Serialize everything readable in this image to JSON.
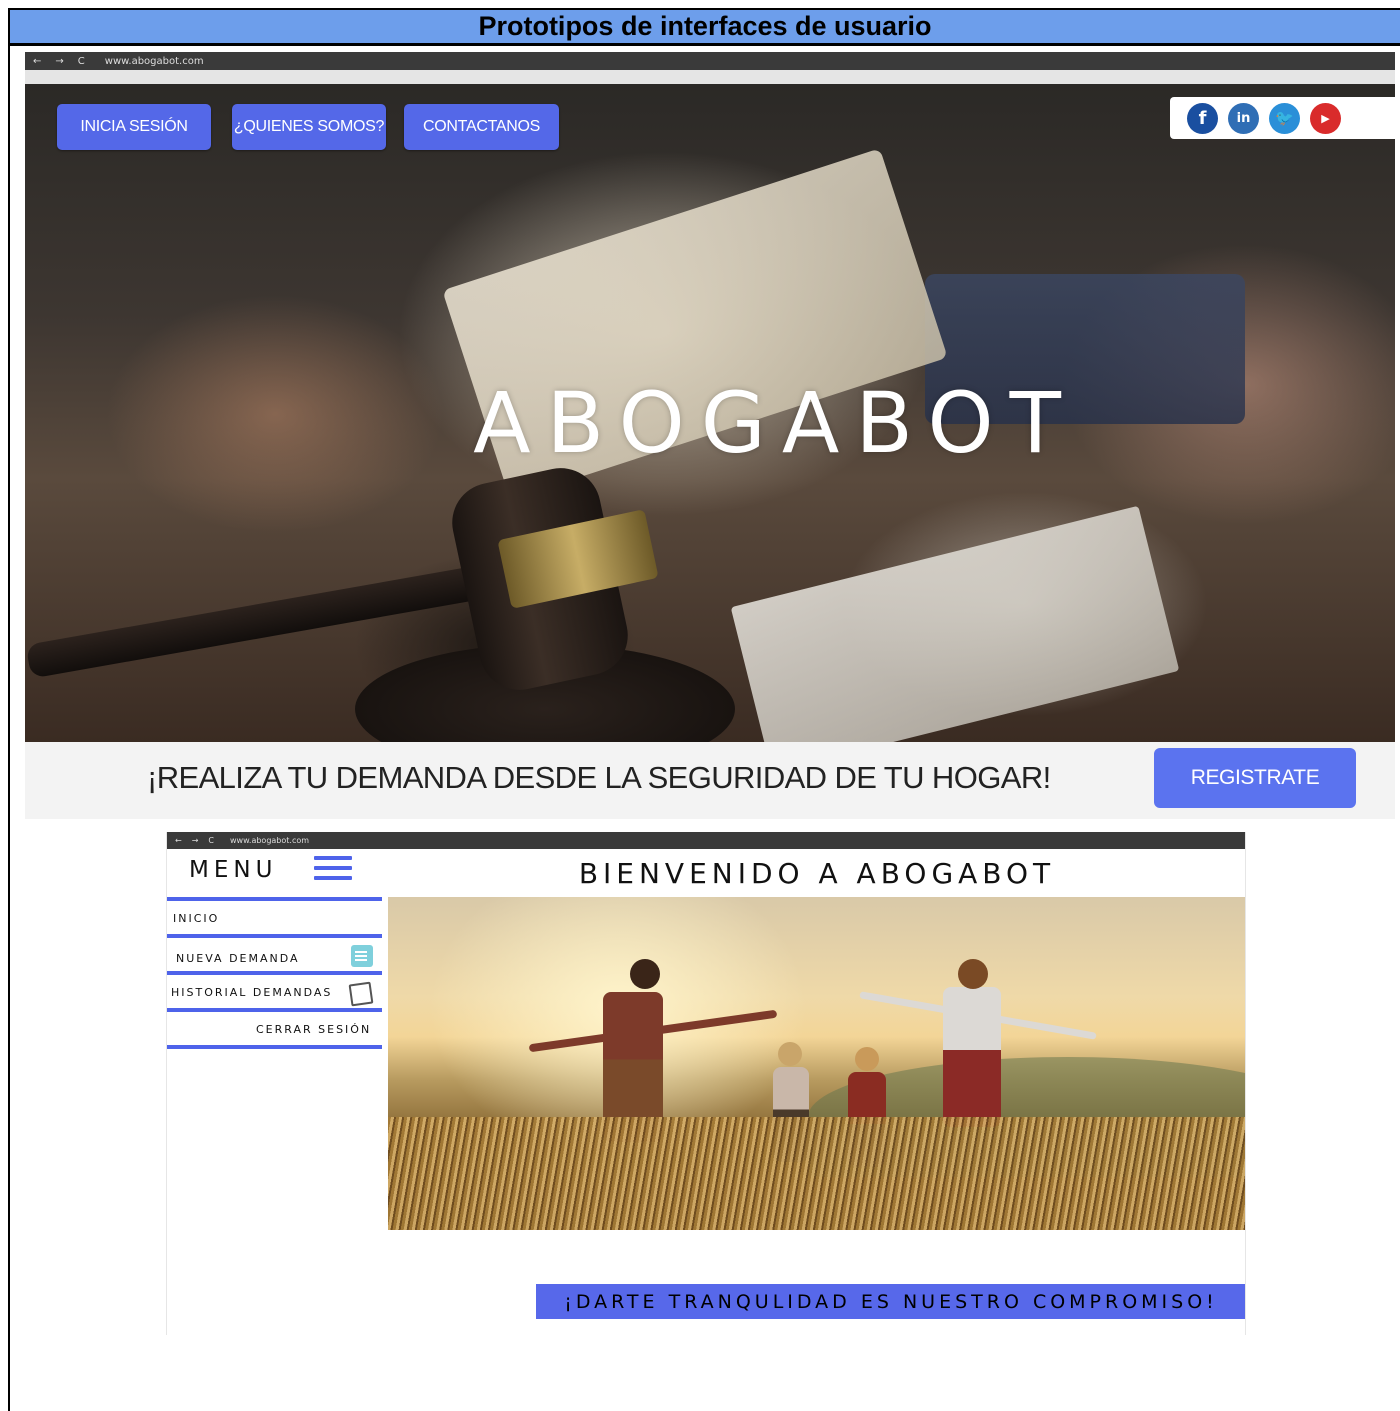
{
  "document": {
    "title": "Prototipos de interfaces de usuario"
  },
  "prototype1": {
    "browser": {
      "url": "www.abogabot.com"
    },
    "nav": {
      "login": "INICIA SESIÓN",
      "about": "¿QUIENES SOMOS?",
      "contact": "CONTACTANOS"
    },
    "social": {
      "facebook": "f",
      "linkedin": "in",
      "twitter": "🐦",
      "youtube": "▶",
      "icons": [
        "facebook-icon",
        "linkedin-icon",
        "twitter-icon",
        "youtube-icon"
      ]
    },
    "brand": "ABOGABOT",
    "tagline": "¡REALIZA TU DEMANDA DESDE LA SEGURIDAD DE TU HOGAR!",
    "register_button": "REGISTRATE",
    "colors": {
      "button": "#5468e8",
      "register": "#5b73ef"
    }
  },
  "prototype2": {
    "browser": {
      "url": "www.abogabot.com"
    },
    "menu_title": "MENU",
    "menu_items": [
      {
        "label": "INICIO"
      },
      {
        "label": "NUEVA DEMANDA",
        "icon": "document-icon"
      },
      {
        "label": "HISTORIAL DEMANDAS",
        "icon": "history-icon"
      },
      {
        "label": "CERRAR SESIÓN"
      }
    ],
    "welcome": "BIENVENIDO A ABOGABOT",
    "banner": "¡DARTE TRANQULIDAD ES NUESTRO COMPROMISO!",
    "colors": {
      "accent": "#4e63ea",
      "banner": "#5768ea"
    }
  }
}
